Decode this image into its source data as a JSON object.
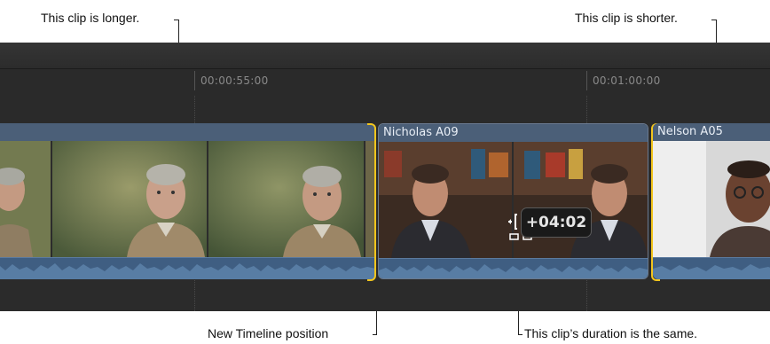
{
  "callouts": {
    "longer": "This clip is longer.",
    "shorter": "This clip is shorter.",
    "new_position": "New Timeline position",
    "same_duration": "This clip’s duration is the same."
  },
  "ruler": {
    "timecodes": [
      "00:00:55:00",
      "00:01:00:00"
    ]
  },
  "clips": [
    {
      "name": ""
    },
    {
      "name": "Nicholas A09"
    },
    {
      "name": "Nelson A05"
    }
  ],
  "duration_change": "+04:02",
  "colors": {
    "trim_bracket": "#f2c51d",
    "clip_header": "#4b5f78",
    "audio": "#3f5e82"
  },
  "icons": [
    "trim-cursor-icon"
  ]
}
